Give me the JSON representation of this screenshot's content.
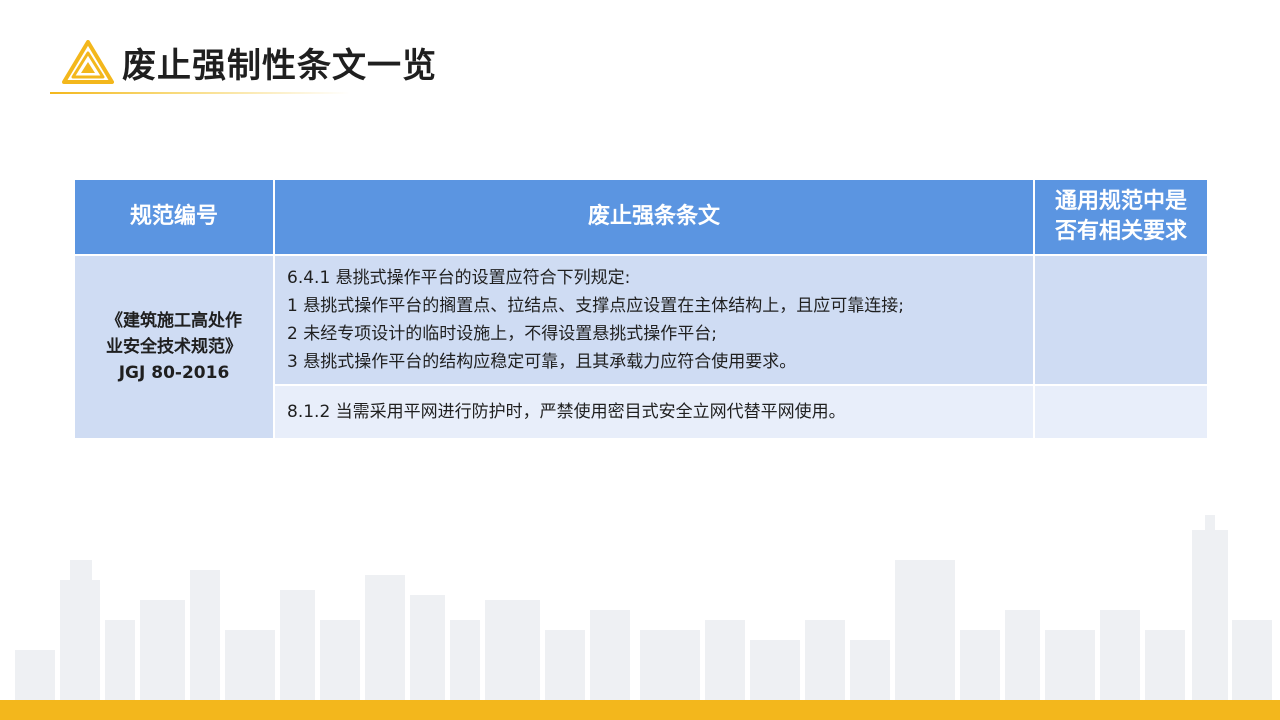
{
  "header": {
    "title": "废止强制性条文一览",
    "colors": {
      "accent": "#f3b71c",
      "table_header": "#5b95e1",
      "row_dark": "#cfdcf3",
      "row_light": "#e8eefa"
    }
  },
  "table": {
    "columns": [
      "规范编号",
      "废止强条条文",
      "通用规范中是否有相关要求"
    ],
    "column3_lines": [
      "通用规范中是",
      "否有相关要求"
    ],
    "standard": {
      "lines": [
        "《建筑施工高处作",
        "业安全技术规范》",
        "JGJ 80-2016"
      ]
    },
    "rows": [
      {
        "clause_lines": [
          "6.4.1 悬挑式操作平台的设置应符合下列规定:",
          "1 悬挑式操作平台的搁置点、拉结点、支撑点应设置在主体结构上，且应可靠连接;",
          "2 未经专项设计的临时设施上，不得设置悬挑式操作平台;",
          "3 悬挑式操作平台的结构应稳定可靠，且其承载力应符合使用要求。"
        ],
        "requirement": ""
      },
      {
        "clause_lines": [
          "8.1.2 当需采用平网进行防护时，严禁使用密目式安全立网代替平网使用。"
        ],
        "requirement": ""
      }
    ]
  },
  "decor": {
    "icons": [
      "triangle-logo-icon",
      "city-skyline-icon"
    ]
  }
}
